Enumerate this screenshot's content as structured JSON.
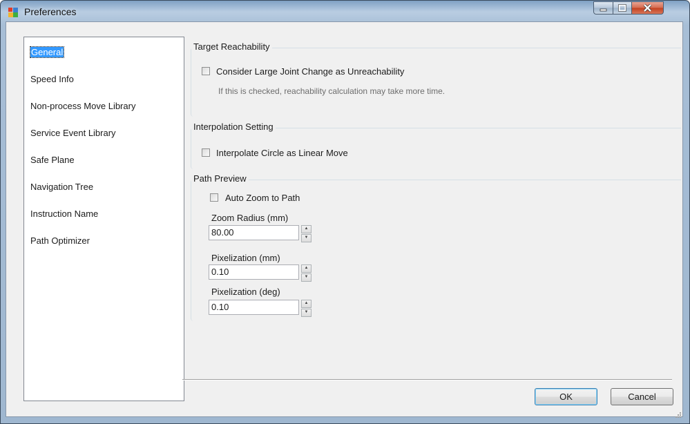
{
  "window": {
    "title": "Preferences"
  },
  "nav": {
    "items": [
      {
        "label": "General",
        "selected": true
      },
      {
        "label": "Speed Info"
      },
      {
        "label": "Non-process Move Library"
      },
      {
        "label": "Service Event Library"
      },
      {
        "label": "Safe Plane"
      },
      {
        "label": "Navigation Tree"
      },
      {
        "label": "Instruction Name"
      },
      {
        "label": "Path Optimizer"
      }
    ]
  },
  "target_reachability": {
    "title": "Target Reachability",
    "checkbox_label": "Consider Large Joint Change as Unreachability",
    "checked": false,
    "hint": "If this is checked, reachability calculation may take more time."
  },
  "interpolation": {
    "title": "Interpolation Setting",
    "checkbox_label": "Interpolate Circle as Linear Move",
    "checked": false
  },
  "path_preview": {
    "title": "Path Preview",
    "auto_zoom_label": "Auto Zoom to Path",
    "auto_zoom_checked": false,
    "zoom_radius_label": "Zoom Radius (mm)",
    "zoom_radius_value": "80.00",
    "pix_mm_label": "Pixelization (mm)",
    "pix_mm_value": "0.10",
    "pix_deg_label": "Pixelization (deg)",
    "pix_deg_value": "0.10"
  },
  "buttons": {
    "ok": "OK",
    "cancel": "Cancel"
  },
  "icons": {
    "spin_up": "▲",
    "spin_down": "▼"
  },
  "colors": {
    "selection": "#3399ff",
    "close_button": "#c3401f"
  }
}
